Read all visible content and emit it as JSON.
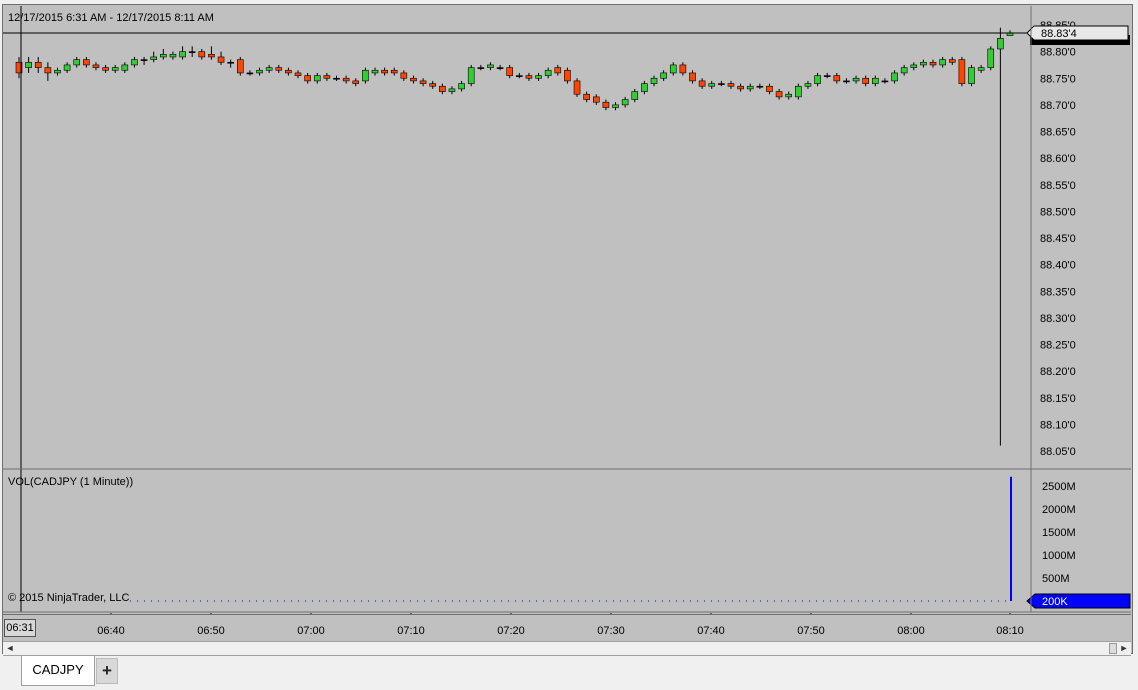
{
  "window": {
    "date_range": "12/17/2015 6:31 AM - 12/17/2015 8:11 AM",
    "copyright": "© 2015 NinjaTrader, LLC"
  },
  "price_panel": {
    "last_price_label": "88.83'4",
    "price_axis_labels": [
      "88.85'0",
      "88.80'0",
      "88.75'0",
      "88.70'0",
      "88.65'0",
      "88.60'0",
      "88.55'0",
      "88.50'0",
      "88.45'0",
      "88.40'0",
      "88.35'0",
      "88.30'0",
      "88.25'0",
      "88.20'0",
      "88.15'0",
      "88.10'0",
      "88.05'0"
    ],
    "price_axis_values": [
      88.85,
      88.8,
      88.75,
      88.7,
      88.65,
      88.6,
      88.55,
      88.5,
      88.45,
      88.4,
      88.35,
      88.3,
      88.25,
      88.2,
      88.15,
      88.1,
      88.05
    ],
    "crosshair_price": 88.835,
    "candles": [
      [
        88.78,
        88.76,
        88.79,
        88.75
      ],
      [
        88.77,
        88.78,
        88.79,
        88.76
      ],
      [
        88.78,
        88.77,
        88.79,
        88.76
      ],
      [
        88.77,
        88.76,
        88.78,
        88.745
      ],
      [
        88.76,
        88.765,
        88.77,
        88.755
      ],
      [
        88.765,
        88.775,
        88.78,
        88.76
      ],
      [
        88.775,
        88.785,
        88.79,
        88.77
      ],
      [
        88.785,
        88.775,
        88.79,
        88.77
      ],
      [
        88.775,
        88.77,
        88.78,
        88.765
      ],
      [
        88.77,
        88.765,
        88.775,
        88.76
      ],
      [
        88.765,
        88.77,
        88.775,
        88.76
      ],
      [
        88.765,
        88.775,
        88.78,
        88.76
      ],
      [
        88.775,
        88.785,
        88.79,
        88.77
      ],
      [
        88.785,
        88.785,
        88.79,
        88.775
      ],
      [
        88.785,
        88.79,
        88.8,
        88.78
      ],
      [
        88.79,
        88.795,
        88.805,
        88.785
      ],
      [
        88.79,
        88.795,
        88.8,
        88.785
      ],
      [
        88.79,
        88.8,
        88.81,
        88.785
      ],
      [
        88.8,
        88.8,
        88.81,
        88.79
      ],
      [
        88.8,
        88.79,
        88.805,
        88.785
      ],
      [
        88.795,
        88.79,
        88.81,
        88.785
      ],
      [
        88.79,
        88.78,
        88.8,
        88.775
      ],
      [
        88.78,
        88.78,
        88.785,
        88.77
      ],
      [
        88.785,
        88.76,
        88.79,
        88.755
      ],
      [
        88.76,
        88.76,
        88.765,
        88.755
      ],
      [
        88.76,
        88.765,
        88.77,
        88.755
      ],
      [
        88.765,
        88.77,
        88.775,
        88.76
      ],
      [
        88.77,
        88.765,
        88.775,
        88.76
      ],
      [
        88.765,
        88.76,
        88.77,
        88.755
      ],
      [
        88.76,
        88.755,
        88.765,
        88.75
      ],
      [
        88.755,
        88.745,
        88.76,
        88.74
      ],
      [
        88.745,
        88.755,
        88.76,
        88.74
      ],
      [
        88.755,
        88.75,
        88.76,
        88.745
      ],
      [
        88.75,
        88.75,
        88.755,
        88.745
      ],
      [
        88.75,
        88.745,
        88.755,
        88.74
      ],
      [
        88.745,
        88.74,
        88.75,
        88.735
      ],
      [
        88.745,
        88.765,
        88.77,
        88.74
      ],
      [
        88.76,
        88.765,
        88.77,
        88.755
      ],
      [
        88.765,
        88.76,
        88.77,
        88.755
      ],
      [
        88.765,
        88.76,
        88.77,
        88.755
      ],
      [
        88.76,
        88.75,
        88.765,
        88.745
      ],
      [
        88.75,
        88.745,
        88.755,
        88.74
      ],
      [
        88.745,
        88.74,
        88.75,
        88.735
      ],
      [
        88.74,
        88.735,
        88.745,
        88.73
      ],
      [
        88.735,
        88.725,
        88.74,
        88.72
      ],
      [
        88.725,
        88.73,
        88.735,
        88.72
      ],
      [
        88.73,
        88.74,
        88.745,
        88.725
      ],
      [
        88.74,
        88.77,
        88.775,
        88.735
      ],
      [
        88.77,
        88.77,
        88.775,
        88.765
      ],
      [
        88.77,
        88.775,
        88.78,
        88.765
      ],
      [
        88.77,
        88.77,
        88.775,
        88.765
      ],
      [
        88.77,
        88.755,
        88.775,
        88.75
      ],
      [
        88.755,
        88.755,
        88.76,
        88.75
      ],
      [
        88.755,
        88.75,
        88.76,
        88.745
      ],
      [
        88.75,
        88.755,
        88.76,
        88.745
      ],
      [
        88.755,
        88.765,
        88.77,
        88.75
      ],
      [
        88.77,
        88.76,
        88.775,
        88.755
      ],
      [
        88.765,
        88.745,
        88.77,
        88.74
      ],
      [
        88.745,
        88.72,
        88.75,
        88.715
      ],
      [
        88.72,
        88.71,
        88.725,
        88.705
      ],
      [
        88.715,
        88.705,
        88.72,
        88.7
      ],
      [
        88.705,
        88.695,
        88.71,
        88.69
      ],
      [
        88.695,
        88.7,
        88.705,
        88.69
      ],
      [
        88.7,
        88.71,
        88.715,
        88.695
      ],
      [
        88.71,
        88.725,
        88.73,
        88.705
      ],
      [
        88.725,
        88.74,
        88.745,
        88.72
      ],
      [
        88.74,
        88.75,
        88.755,
        88.735
      ],
      [
        88.75,
        88.76,
        88.765,
        88.745
      ],
      [
        88.76,
        88.775,
        88.78,
        88.755
      ],
      [
        88.775,
        88.76,
        88.78,
        88.755
      ],
      [
        88.76,
        88.745,
        88.765,
        88.74
      ],
      [
        88.745,
        88.735,
        88.75,
        88.73
      ],
      [
        88.735,
        88.74,
        88.745,
        88.73
      ],
      [
        88.74,
        88.74,
        88.745,
        88.735
      ],
      [
        88.74,
        88.735,
        88.745,
        88.73
      ],
      [
        88.735,
        88.73,
        88.74,
        88.725
      ],
      [
        88.73,
        88.735,
        88.74,
        88.725
      ],
      [
        88.735,
        88.735,
        88.74,
        88.73
      ],
      [
        88.735,
        88.725,
        88.74,
        88.72
      ],
      [
        88.725,
        88.715,
        88.73,
        88.71
      ],
      [
        88.715,
        88.72,
        88.725,
        88.71
      ],
      [
        88.715,
        88.735,
        88.74,
        88.71
      ],
      [
        88.735,
        88.74,
        88.745,
        88.73
      ],
      [
        88.74,
        88.755,
        88.76,
        88.735
      ],
      [
        88.755,
        88.755,
        88.76,
        88.75
      ],
      [
        88.755,
        88.745,
        88.76,
        88.74
      ],
      [
        88.745,
        88.745,
        88.75,
        88.74
      ],
      [
        88.745,
        88.75,
        88.755,
        88.74
      ],
      [
        88.75,
        88.74,
        88.755,
        88.735
      ],
      [
        88.74,
        88.75,
        88.755,
        88.735
      ],
      [
        88.745,
        88.745,
        88.75,
        88.74
      ],
      [
        88.745,
        88.76,
        88.765,
        88.74
      ],
      [
        88.76,
        88.77,
        88.775,
        88.755
      ],
      [
        88.77,
        88.775,
        88.78,
        88.765
      ],
      [
        88.775,
        88.78,
        88.785,
        88.77
      ],
      [
        88.78,
        88.775,
        88.785,
        88.77
      ],
      [
        88.775,
        88.785,
        88.79,
        88.77
      ],
      [
        88.785,
        88.78,
        88.79,
        88.775
      ],
      [
        88.785,
        88.74,
        88.79,
        88.735
      ],
      [
        88.74,
        88.77,
        88.775,
        88.735
      ],
      [
        88.765,
        88.77,
        88.775,
        88.76
      ],
      [
        88.77,
        88.805,
        88.81,
        88.765
      ],
      [
        88.805,
        88.825,
        88.845,
        88.06
      ],
      [
        88.83,
        88.835,
        88.84,
        88.83
      ]
    ]
  },
  "volume_panel": {
    "title": "VOL(CADJPY (1 Minute))",
    "axis_labels": [
      "2500M",
      "2000M",
      "1500M",
      "1000M",
      "500M"
    ],
    "axis_values": [
      2500,
      2000,
      1500,
      1000,
      500
    ],
    "last_volume_label": "200K",
    "spike_value_m": 2700
  },
  "time_axis": {
    "first_label": "06:31",
    "labels": [
      "06:40",
      "06:50",
      "07:00",
      "07:10",
      "07:20",
      "07:30",
      "07:40",
      "07:50",
      "08:00",
      "08:10"
    ]
  },
  "tabs": [
    {
      "label": "CADJPY",
      "active": true
    }
  ],
  "add_tab_label": "+",
  "colors": {
    "background": "#c0c0c0",
    "up_candle": "#32cd32",
    "down_candle": "#ff4500",
    "volume_bar": "#0000ff",
    "grid_line": "#000000"
  }
}
